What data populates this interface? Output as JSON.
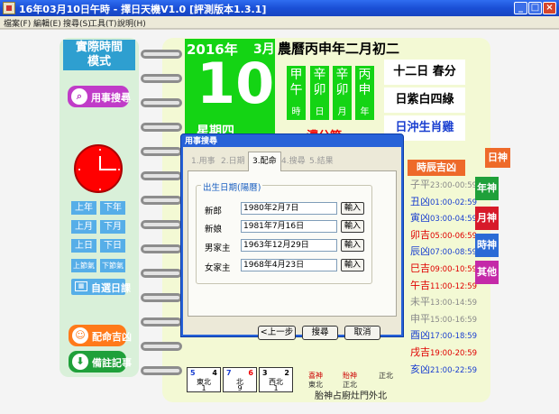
{
  "window": {
    "title": "16年03月10日午時 - 擇日天機V1.0 [評測版本1.3.1]"
  },
  "menu": [
    "檔案(F)",
    "編輯(E)",
    "搜尋(S)",
    "工具(T)",
    "說明(H)"
  ],
  "left_panel": {
    "mode_title_line1": "實際時間",
    "mode_title_line2": "模式",
    "search_label": "用事搜尋",
    "nav": {
      "prev_year": "上年",
      "next_year": "下年",
      "prev_month": "上月",
      "next_month": "下月",
      "prev_day": "上日",
      "next_day": "下日",
      "prev_term": "上節氣",
      "next_term": "下節氣"
    },
    "custom_label": "自選日課",
    "match_label": "配命吉凶",
    "note_label": "備註記事"
  },
  "calendar": {
    "year": "2016年",
    "month": "3月",
    "day": "10",
    "weekday": "星期四",
    "lunar": "農曆丙申年二月初二",
    "ganzhi": [
      {
        "top": "甲午",
        "label": "時"
      },
      {
        "top": "辛卯",
        "label": "日"
      },
      {
        "top": "辛卯",
        "label": "月"
      },
      {
        "top": "丙申",
        "label": "年"
      }
    ],
    "officer": "十二日 春分",
    "star": "日紫白四綠",
    "clash": "日沖生肖雞",
    "season": "濃分節"
  },
  "hours": {
    "header": "時辰吉凶",
    "rows": [
      {
        "name": "子平",
        "range": "23:00-00:59",
        "color": "#8a8a8a"
      },
      {
        "name": "丑凶",
        "range": "01:00-02:59",
        "color": "#1a3fd0"
      },
      {
        "name": "寅凶",
        "range": "03:00-04:59",
        "color": "#1a3fd0"
      },
      {
        "name": "卯吉",
        "range": "05:00-06:59",
        "color": "#e00000"
      },
      {
        "name": "辰凶",
        "range": "07:00-08:59",
        "color": "#1a3fd0"
      },
      {
        "name": "巳吉",
        "range": "09:00-10:59",
        "color": "#e00000"
      },
      {
        "name": "午吉",
        "range": "11:00-12:59",
        "color": "#e00000"
      },
      {
        "name": "未平",
        "range": "13:00-14:59",
        "color": "#8a8a8a"
      },
      {
        "name": "申平",
        "range": "15:00-16:59",
        "color": "#8a8a8a"
      },
      {
        "name": "酉凶",
        "range": "17:00-18:59",
        "color": "#1a3fd0"
      },
      {
        "name": "戌吉",
        "range": "19:00-20:59",
        "color": "#e00000"
      },
      {
        "name": "亥凶",
        "range": "21:00-22:59",
        "color": "#1a3fd0"
      }
    ]
  },
  "gods": [
    {
      "label": "日神",
      "color": "#ee6a2a"
    },
    {
      "label": "年神",
      "color": "#1fa03a"
    },
    {
      "label": "月神",
      "color": "#d71a2a"
    },
    {
      "label": "時神",
      "color": "#2b6bd6"
    },
    {
      "label": "其他",
      "color": "#c42aa8"
    }
  ],
  "compass": [
    {
      "tl": "5",
      "tr": "4",
      "c1": "東北",
      "c2": "1"
    },
    {
      "tl": "7",
      "tr": "6",
      "c1": "北",
      "c2": "9"
    },
    {
      "tl": "3",
      "tr": "2",
      "c1": "西北",
      "c2": "1"
    }
  ],
  "directions": [
    {
      "title": "喜神",
      "dir": "東北"
    },
    {
      "title": "貽神",
      "dir": "正北"
    },
    {
      "title": "",
      "dir": "正北"
    }
  ],
  "fetal": "胎神占廚灶門外北",
  "dialog": {
    "title": "用事搜尋",
    "tabs": [
      "1.用事",
      "2.日期",
      "3.配命",
      "4.搜尋",
      "5.結果"
    ],
    "group_title": "出生日期(陽曆)",
    "fields": [
      {
        "label": "新郎",
        "value": "1980年2月7日"
      },
      {
        "label": "新娘",
        "value": "1981年7月16日"
      },
      {
        "label": "男家主",
        "value": "1963年12月29日"
      },
      {
        "label": "女家主",
        "value": "1968年4月23日"
      }
    ],
    "input_btn": "輸入",
    "prev": "<上一步",
    "search": "搜尋",
    "cancel": "取消"
  }
}
